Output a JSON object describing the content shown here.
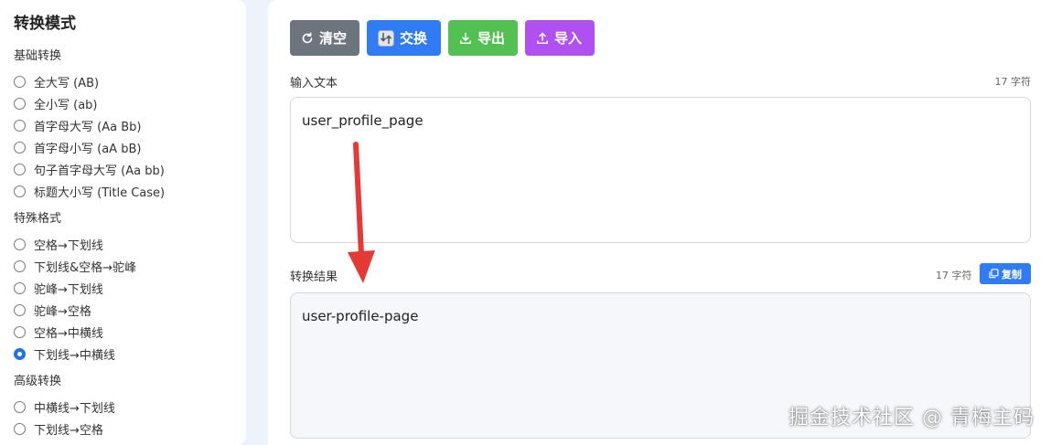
{
  "sidebar": {
    "title": "转换模式",
    "groups": [
      {
        "title": "基础转换",
        "options": [
          {
            "label": "全大写 (AB)",
            "checked": false
          },
          {
            "label": "全小写 (ab)",
            "checked": false
          },
          {
            "label": "首字母大写 (Aa Bb)",
            "checked": false
          },
          {
            "label": "首字母小写 (aA bB)",
            "checked": false
          },
          {
            "label": "句子首字母大写 (Aa bb)",
            "checked": false
          },
          {
            "label": "标题大小写 (Title Case)",
            "checked": false
          }
        ]
      },
      {
        "title": "特殊格式",
        "options": [
          {
            "label": "空格→下划线",
            "checked": false
          },
          {
            "label": "下划线&空格→驼峰",
            "checked": false
          },
          {
            "label": "驼峰→下划线",
            "checked": false
          },
          {
            "label": "驼峰→空格",
            "checked": false
          },
          {
            "label": "空格→中横线",
            "checked": false
          },
          {
            "label": "下划线→中横线",
            "checked": true
          }
        ]
      },
      {
        "title": "高级转换",
        "options": [
          {
            "label": "中横线→下划线",
            "checked": false
          },
          {
            "label": "下划线→空格",
            "checked": false
          }
        ]
      }
    ]
  },
  "toolbar": {
    "clear_label": "清空",
    "swap_label": "交换",
    "export_label": "导出",
    "import_label": "导入"
  },
  "input": {
    "label": "输入文本",
    "count": "17 字符",
    "value": "user_profile_page"
  },
  "output": {
    "label": "转换结果",
    "count": "17 字符",
    "copy_label": "复制",
    "value": "user-profile-page"
  },
  "watermark": "掘金技术社区 @ 青梅主码",
  "colors": {
    "clear": "#6c757d",
    "swap": "#2f7cf6",
    "export": "#52c152",
    "import": "#b050f0",
    "annotation_arrow": "#e53935"
  }
}
